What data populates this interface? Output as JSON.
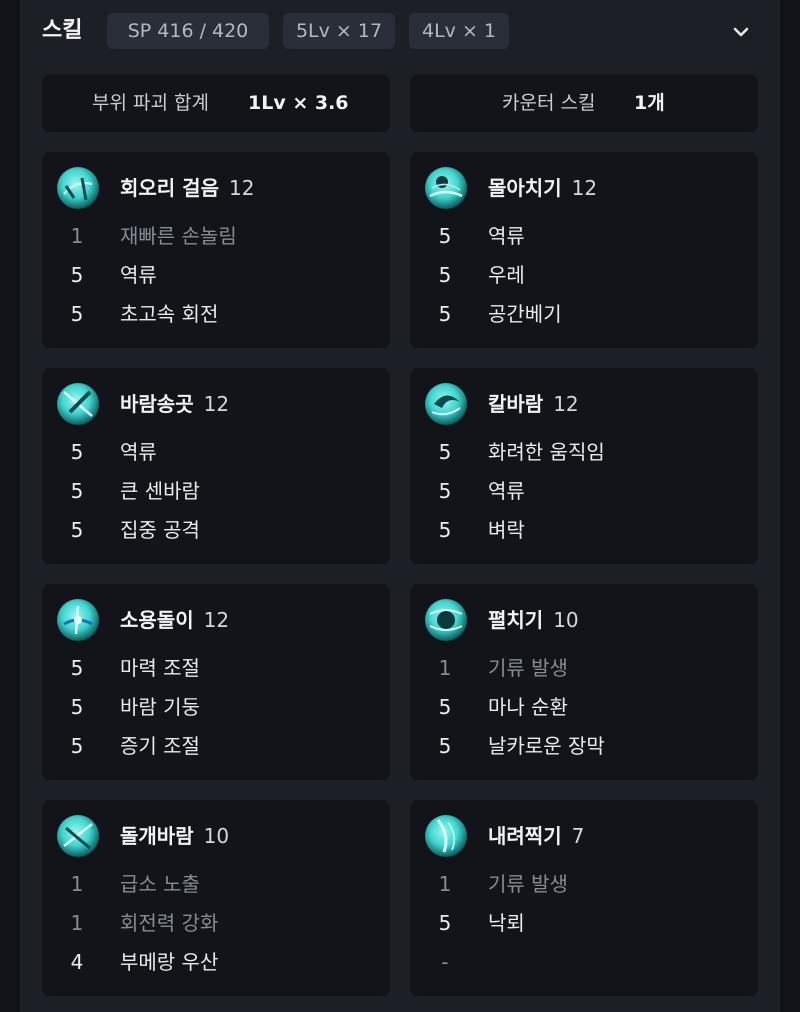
{
  "header": {
    "title": "스킬",
    "chips": [
      "SP 416 / 420",
      "5Lv × 17",
      "4Lv × 1"
    ]
  },
  "summary": {
    "part_break_label": "부위 파괴 합계",
    "part_break_value": "1Lv × 3.6",
    "counter_label": "카운터 스킬",
    "counter_value": "1개"
  },
  "skills": [
    {
      "name": "회오리 걸음",
      "level": "12",
      "icon": "whirlwind-step-icon",
      "mods": [
        {
          "lv": "1",
          "name": "재빠른 손놀림",
          "dim": true
        },
        {
          "lv": "5",
          "name": "역류"
        },
        {
          "lv": "5",
          "name": "초고속 회전"
        }
      ]
    },
    {
      "name": "몰아치기",
      "level": "12",
      "icon": "onslaught-icon",
      "mods": [
        {
          "lv": "5",
          "name": "역류"
        },
        {
          "lv": "5",
          "name": "우레"
        },
        {
          "lv": "5",
          "name": "공간베기"
        }
      ]
    },
    {
      "name": "바람송곳",
      "level": "12",
      "icon": "wind-drill-icon",
      "mods": [
        {
          "lv": "5",
          "name": "역류"
        },
        {
          "lv": "5",
          "name": "큰 센바람"
        },
        {
          "lv": "5",
          "name": "집중 공격"
        }
      ]
    },
    {
      "name": "칼바람",
      "level": "12",
      "icon": "blade-wind-icon",
      "mods": [
        {
          "lv": "5",
          "name": "화려한 움직임"
        },
        {
          "lv": "5",
          "name": "역류"
        },
        {
          "lv": "5",
          "name": "벼락"
        }
      ]
    },
    {
      "name": "소용돌이",
      "level": "12",
      "icon": "vortex-icon",
      "mods": [
        {
          "lv": "5",
          "name": "마력 조절"
        },
        {
          "lv": "5",
          "name": "바람 기둥"
        },
        {
          "lv": "5",
          "name": "증기 조절"
        }
      ]
    },
    {
      "name": "펼치기",
      "level": "10",
      "icon": "unfold-icon",
      "mods": [
        {
          "lv": "1",
          "name": "기류 발생",
          "dim": true
        },
        {
          "lv": "5",
          "name": "마나 순환"
        },
        {
          "lv": "5",
          "name": "날카로운 장막"
        }
      ]
    },
    {
      "name": "돌개바람",
      "level": "10",
      "icon": "gust-icon",
      "mods": [
        {
          "lv": "1",
          "name": "급소 노출",
          "dim": true
        },
        {
          "lv": "1",
          "name": "회전력 강화",
          "dim": true
        },
        {
          "lv": "4",
          "name": "부메랑 우산"
        }
      ]
    },
    {
      "name": "내려찍기",
      "level": "7",
      "icon": "slam-down-icon",
      "mods": [
        {
          "lv": "1",
          "name": "기류 발생",
          "dim": true
        },
        {
          "lv": "5",
          "name": "낙뢰"
        },
        {
          "lv": "-",
          "name": "",
          "dim": true
        }
      ]
    }
  ],
  "colors": {
    "background": "#131419",
    "panel": "#1c1f26",
    "card": "#121419",
    "chip": "#2a2e38",
    "icon_accent": "#3fd6cf"
  }
}
